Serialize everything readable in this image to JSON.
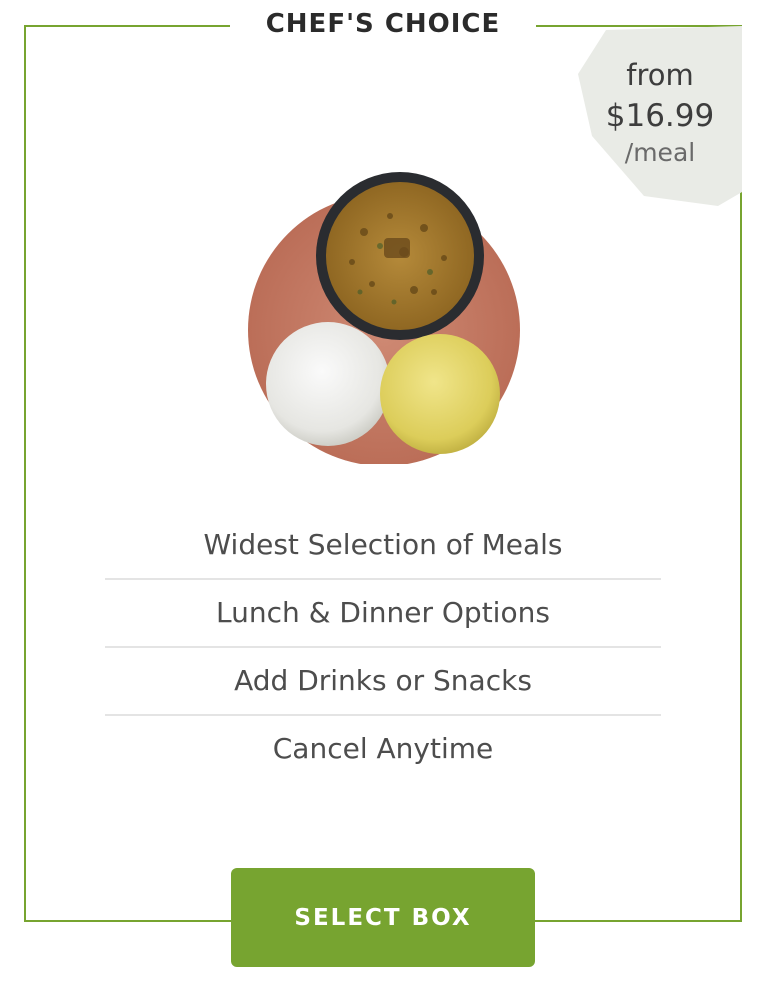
{
  "card": {
    "title": "CHEF'S CHOICE",
    "border_color": "#77a430"
  },
  "price_badge": {
    "prefix": "from",
    "amount": "$16.99",
    "unit": "/meal",
    "background_color": "#e9ebe6"
  },
  "meal_image": {
    "description_icon": "meal-plate-image"
  },
  "features": [
    {
      "label": "Widest Selection of Meals"
    },
    {
      "label": "Lunch & Dinner Options"
    },
    {
      "label": "Add Drinks or Snacks"
    },
    {
      "label": "Cancel Anytime"
    }
  ],
  "cta": {
    "label": "SELECT BOX",
    "color": "#77a430"
  }
}
